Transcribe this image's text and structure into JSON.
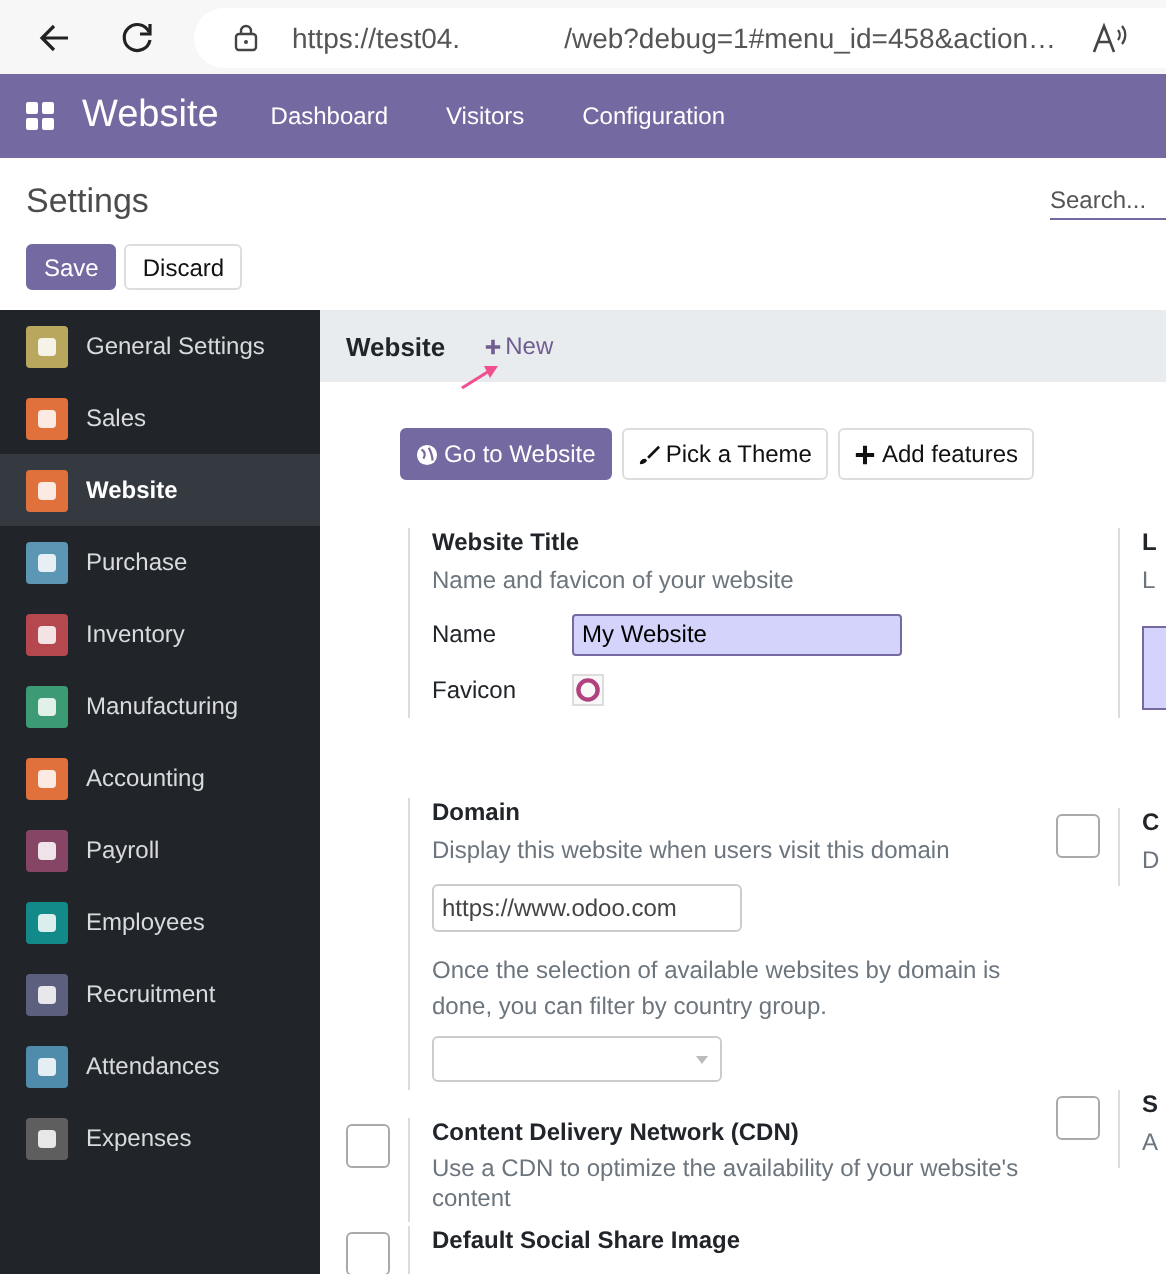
{
  "browser": {
    "url_start": "https://test04.",
    "url_end": "/web?debug=1#menu_id=458&action…"
  },
  "navbar": {
    "app": "Website",
    "menu": [
      "Dashboard",
      "Visitors",
      "Configuration"
    ]
  },
  "control_panel": {
    "title": "Settings",
    "search": {
      "placeholder": "Search..."
    },
    "buttons": [
      {
        "label": "Save",
        "kind": "primary"
      },
      {
        "label": "Discard",
        "kind": "secondary"
      }
    ]
  },
  "sidebar": {
    "items": [
      {
        "label": "General Settings",
        "color": "#b8a75c",
        "selected": false
      },
      {
        "label": "Sales",
        "color": "#e0703c",
        "selected": false
      },
      {
        "label": "Website",
        "color": "#e0703c",
        "selected": true
      },
      {
        "label": "Purchase",
        "color": "#5b97b4",
        "selected": false
      },
      {
        "label": "Inventory",
        "color": "#b5474f",
        "selected": false
      },
      {
        "label": "Manufacturing",
        "color": "#3c9b74",
        "selected": false
      },
      {
        "label": "Accounting",
        "color": "#e0703c",
        "selected": false
      },
      {
        "label": "Payroll",
        "color": "#874566",
        "selected": false
      },
      {
        "label": "Employees",
        "color": "#138a8a",
        "selected": false
      },
      {
        "label": "Recruitment",
        "color": "#5d5f7e",
        "selected": false
      },
      {
        "label": "Attendances",
        "color": "#4f8cab",
        "selected": false
      },
      {
        "label": "Expenses",
        "color": "#5e5e5e",
        "selected": false
      }
    ]
  },
  "section": {
    "title": "Website",
    "new_button": "New"
  },
  "actions": [
    {
      "label": "Go to Website",
      "kind": "primary"
    },
    {
      "label": "Pick a Theme",
      "kind": "brush"
    },
    {
      "label": "Add features",
      "kind": "plus"
    }
  ],
  "left_settings": [
    {
      "kind": "fields",
      "title": "Website Title",
      "description": "Name and favicon of your website",
      "name_label": "Name",
      "name_value": "My Website",
      "favicon_label": "Favicon"
    },
    {
      "kind": "domain",
      "title": "Domain",
      "description": "Display this website when users visit this domain",
      "domain_value": "https://www.odoo.com",
      "note": "Once the selection of available websites by domain is done, you can filter by country group."
    },
    {
      "kind": "checkbox",
      "checked": false,
      "title": "Content Delivery Network (CDN)",
      "description": "Use a CDN to optimize the availability of your website's content"
    },
    {
      "kind": "checkbox",
      "checked": false,
      "title": "Default Social Share Image"
    }
  ],
  "right_settings": [
    {
      "kind": "fields",
      "title": "L",
      "description": "L"
    },
    {
      "kind": "checkbox",
      "checked": false,
      "title": "C",
      "description": "D"
    },
    {
      "kind": "checkbox",
      "checked": false,
      "title": "S",
      "description": "A"
    }
  ]
}
